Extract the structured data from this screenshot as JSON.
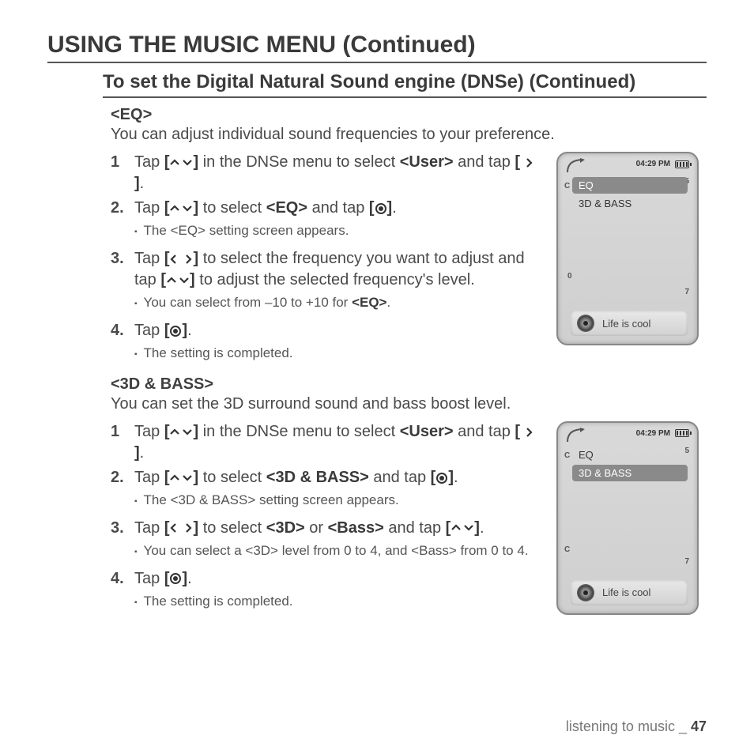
{
  "page": {
    "h1": "USING THE MUSIC MENU (Continued)",
    "h2": "To set the Digital Natural Sound engine (DNSe) (Continued)",
    "footer_section": "listening to music _ ",
    "footer_page": "47"
  },
  "eq": {
    "label": "<EQ>",
    "desc": "You can adjust individual sound frequencies to your preference.",
    "s1_a": "Tap ",
    "s1_b": " in the DNSe menu to select ",
    "s1_user": "<User>",
    "s1_c": " and tap ",
    "s1_d": ".",
    "s2_a": "Tap ",
    "s2_b": " to select ",
    "s2_eq": "<EQ>",
    "s2_c": " and tap ",
    "s2_d": ".",
    "s2_sub": "The <EQ> setting screen appears.",
    "s3_a": "Tap ",
    "s3_b": " to select the frequency you want to adjust and tap ",
    "s3_c": " to adjust the selected frequency's level.",
    "s3_sub_a": "You can select from –10 to +10 for ",
    "s3_sub_b": "<EQ>",
    "s3_sub_c": ".",
    "s4_a": "Tap ",
    "s4_b": ".",
    "s4_sub": "The setting is completed."
  },
  "bass": {
    "label": "<3D & BASS>",
    "desc": "You can set the 3D surround sound and bass boost level.",
    "s1_a": "Tap ",
    "s1_b": " in the DNSe menu to select ",
    "s1_user": "<User>",
    "s1_c": " and tap ",
    "s1_d": ".",
    "s2_a": "Tap ",
    "s2_b": " to select ",
    "s2_lbl": "<3D & BASS>",
    "s2_c": " and tap ",
    "s2_d": ".",
    "s2_sub": "The <3D & BASS> setting screen appears.",
    "s3_a": "Tap ",
    "s3_b": " to select ",
    "s3_3d": "<3D>",
    "s3_or": " or ",
    "s3_bass": "<Bass>",
    "s3_c": " and tap ",
    "s3_d": ".",
    "s3_sub": "You can select a <3D> level from 0 to 4, and <Bass> from 0 to 4.",
    "s4_a": "Tap ",
    "s4_b": ".",
    "s4_sub": "The setting is completed."
  },
  "device": {
    "clock": "04:29 PM",
    "menu_eq": "EQ",
    "menu_bass": "3D & BASS",
    "song": "Life is cool",
    "scale5": "5",
    "scale0": "0",
    "scale7": "7",
    "sideC": "C"
  },
  "nums": {
    "n1": "1",
    "n2": "2.",
    "n3": "3.",
    "n4": "4."
  }
}
